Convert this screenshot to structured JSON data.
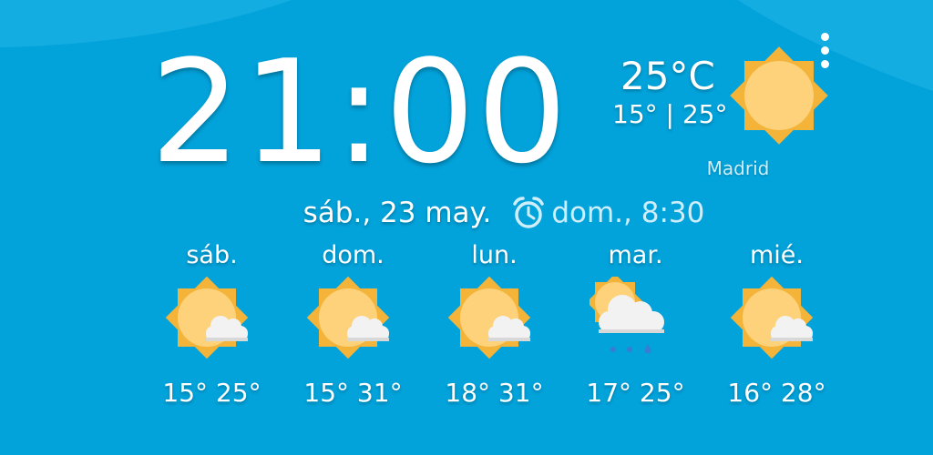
{
  "clock": {
    "time": "21:00"
  },
  "current": {
    "temperature": "25°C",
    "range": "15° | 25°",
    "city": "Madrid",
    "icon": "sun-icon"
  },
  "date": {
    "text": "sáb., 23 may.",
    "alarm_text": "dom., 8:30",
    "alarm_icon": "alarm-clock-icon"
  },
  "menu": {
    "icon": "more-vert-icon"
  },
  "forecast": [
    {
      "day": "sáb.",
      "temps": "15° 25°",
      "icon": "sun-cloud-icon"
    },
    {
      "day": "dom.",
      "temps": "15° 31°",
      "icon": "sun-cloud-icon"
    },
    {
      "day": "lun.",
      "temps": "18° 31°",
      "icon": "sun-cloud-icon"
    },
    {
      "day": "mar.",
      "temps": "17° 25°",
      "icon": "sun-cloud-rain-icon"
    },
    {
      "day": "mié.",
      "temps": "16° 28°",
      "icon": "sun-cloud-icon"
    }
  ],
  "colors": {
    "background": "#02a2da",
    "wave": "#14ade1",
    "sun_outer": "#f4b43a",
    "sun_inner": "#fdd27a",
    "cloud": "#f2f2f2",
    "rain": "#3a7bd5"
  }
}
